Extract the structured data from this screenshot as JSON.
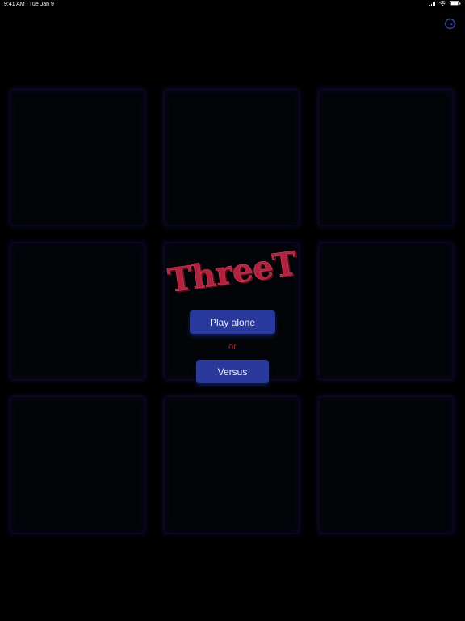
{
  "status_bar": {
    "time": "9:41 AM",
    "date": "Tue Jan 9"
  },
  "icons": {
    "settings": "clock-gear-icon",
    "signal": "signal-icon",
    "wifi": "wifi-icon",
    "battery": "battery-icon"
  },
  "board": {
    "rows": 3,
    "cols": 3,
    "cells": [
      "",
      "",
      "",
      "",
      "",
      "",
      "",
      "",
      ""
    ]
  },
  "title": {
    "text": "ThreeT"
  },
  "menu": {
    "play_alone_label": "Play alone",
    "separator": "or",
    "versus_label": "Versus"
  },
  "colors": {
    "background": "#000000",
    "accent_button": "#2a3a9c",
    "title_red": "#b0233e",
    "separator_red": "#8a2a36",
    "settings_icon": "#3c4fc6"
  }
}
